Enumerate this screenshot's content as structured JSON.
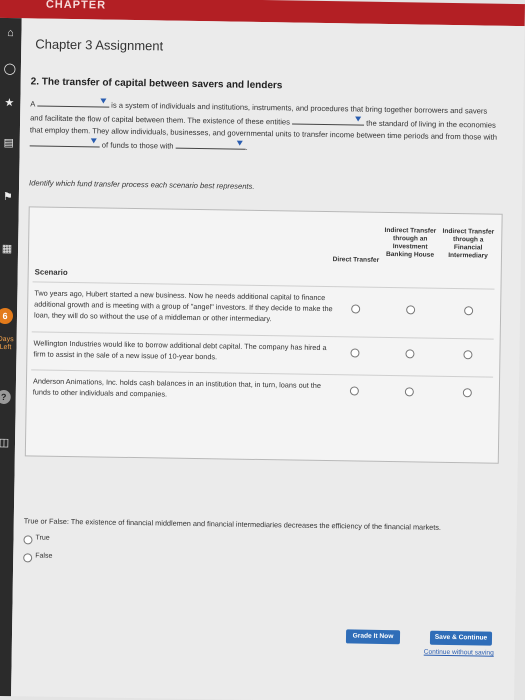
{
  "header": {
    "title": "CHAPTER"
  },
  "chapter": {
    "title": "Chapter 3 Assignment"
  },
  "left_rail": {
    "badge": "6",
    "days_left_label": "Days Left"
  },
  "question": {
    "title": "2. The transfer of capital between savers and lenders",
    "p_before1": "A",
    "p_after1": " is a system of individuals and institutions, instruments, and procedures that bring together borrowers and savers and facilitate the flow of capital between them. The existence of these entities",
    "p_after2": " the standard of living in the economies that employ them. They allow individuals, businesses, and governmental units to transfer income between time periods and from those with",
    "p_after3": " of funds to those with",
    "p_after4": "."
  },
  "instruction": "Identify which fund transfer process each scenario best represents.",
  "table": {
    "scenario_header": "Scenario",
    "columns": [
      "Direct Transfer",
      "Indirect Transfer through an Investment Banking House",
      "Indirect Transfer through a Financial Intermediary"
    ],
    "rows": [
      "Two years ago, Hubert started a new business. Now he needs additional capital to finance additional growth and is meeting with a group of \"angel\" investors. If they decide to make the loan, they will do so without the use of a middleman or other intermediary.",
      "Wellington Industries would like to borrow additional debt capital. The company has hired a firm to assist in the sale of a new issue of 10-year bonds.",
      "Anderson Animations, Inc. holds cash balances in an institution that, in turn, loans out the funds to other individuals and companies."
    ]
  },
  "true_false": {
    "question": "True or False: The existence of financial middlemen and financial intermediaries decreases the efficiency of the financial markets.",
    "options": [
      "True",
      "False"
    ]
  },
  "footer": {
    "grade_button": "Grade It Now",
    "save_button": "Save & Continue",
    "continue_link": "Continue without saving"
  }
}
